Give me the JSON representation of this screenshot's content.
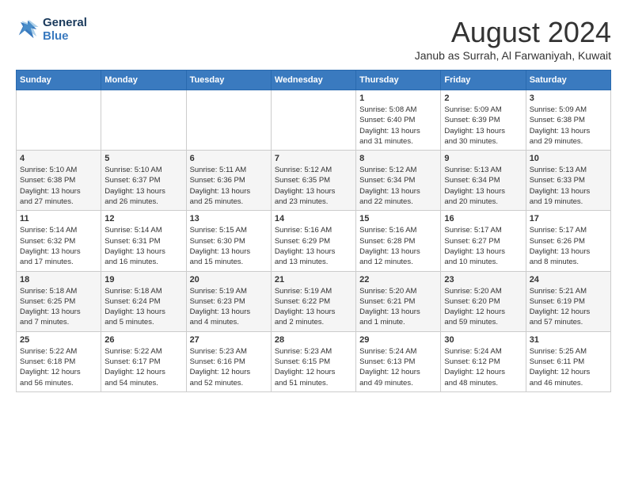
{
  "logo": {
    "line1": "General",
    "line2": "Blue"
  },
  "title": "August 2024",
  "location": "Janub as Surrah, Al Farwaniyah, Kuwait",
  "days_of_week": [
    "Sunday",
    "Monday",
    "Tuesday",
    "Wednesday",
    "Thursday",
    "Friday",
    "Saturday"
  ],
  "weeks": [
    [
      {
        "day": "",
        "detail": ""
      },
      {
        "day": "",
        "detail": ""
      },
      {
        "day": "",
        "detail": ""
      },
      {
        "day": "",
        "detail": ""
      },
      {
        "day": "1",
        "detail": "Sunrise: 5:08 AM\nSunset: 6:40 PM\nDaylight: 13 hours\nand 31 minutes."
      },
      {
        "day": "2",
        "detail": "Sunrise: 5:09 AM\nSunset: 6:39 PM\nDaylight: 13 hours\nand 30 minutes."
      },
      {
        "day": "3",
        "detail": "Sunrise: 5:09 AM\nSunset: 6:38 PM\nDaylight: 13 hours\nand 29 minutes."
      }
    ],
    [
      {
        "day": "4",
        "detail": "Sunrise: 5:10 AM\nSunset: 6:38 PM\nDaylight: 13 hours\nand 27 minutes."
      },
      {
        "day": "5",
        "detail": "Sunrise: 5:10 AM\nSunset: 6:37 PM\nDaylight: 13 hours\nand 26 minutes."
      },
      {
        "day": "6",
        "detail": "Sunrise: 5:11 AM\nSunset: 6:36 PM\nDaylight: 13 hours\nand 25 minutes."
      },
      {
        "day": "7",
        "detail": "Sunrise: 5:12 AM\nSunset: 6:35 PM\nDaylight: 13 hours\nand 23 minutes."
      },
      {
        "day": "8",
        "detail": "Sunrise: 5:12 AM\nSunset: 6:34 PM\nDaylight: 13 hours\nand 22 minutes."
      },
      {
        "day": "9",
        "detail": "Sunrise: 5:13 AM\nSunset: 6:34 PM\nDaylight: 13 hours\nand 20 minutes."
      },
      {
        "day": "10",
        "detail": "Sunrise: 5:13 AM\nSunset: 6:33 PM\nDaylight: 13 hours\nand 19 minutes."
      }
    ],
    [
      {
        "day": "11",
        "detail": "Sunrise: 5:14 AM\nSunset: 6:32 PM\nDaylight: 13 hours\nand 17 minutes."
      },
      {
        "day": "12",
        "detail": "Sunrise: 5:14 AM\nSunset: 6:31 PM\nDaylight: 13 hours\nand 16 minutes."
      },
      {
        "day": "13",
        "detail": "Sunrise: 5:15 AM\nSunset: 6:30 PM\nDaylight: 13 hours\nand 15 minutes."
      },
      {
        "day": "14",
        "detail": "Sunrise: 5:16 AM\nSunset: 6:29 PM\nDaylight: 13 hours\nand 13 minutes."
      },
      {
        "day": "15",
        "detail": "Sunrise: 5:16 AM\nSunset: 6:28 PM\nDaylight: 13 hours\nand 12 minutes."
      },
      {
        "day": "16",
        "detail": "Sunrise: 5:17 AM\nSunset: 6:27 PM\nDaylight: 13 hours\nand 10 minutes."
      },
      {
        "day": "17",
        "detail": "Sunrise: 5:17 AM\nSunset: 6:26 PM\nDaylight: 13 hours\nand 8 minutes."
      }
    ],
    [
      {
        "day": "18",
        "detail": "Sunrise: 5:18 AM\nSunset: 6:25 PM\nDaylight: 13 hours\nand 7 minutes."
      },
      {
        "day": "19",
        "detail": "Sunrise: 5:18 AM\nSunset: 6:24 PM\nDaylight: 13 hours\nand 5 minutes."
      },
      {
        "day": "20",
        "detail": "Sunrise: 5:19 AM\nSunset: 6:23 PM\nDaylight: 13 hours\nand 4 minutes."
      },
      {
        "day": "21",
        "detail": "Sunrise: 5:19 AM\nSunset: 6:22 PM\nDaylight: 13 hours\nand 2 minutes."
      },
      {
        "day": "22",
        "detail": "Sunrise: 5:20 AM\nSunset: 6:21 PM\nDaylight: 13 hours\nand 1 minute."
      },
      {
        "day": "23",
        "detail": "Sunrise: 5:20 AM\nSunset: 6:20 PM\nDaylight: 12 hours\nand 59 minutes."
      },
      {
        "day": "24",
        "detail": "Sunrise: 5:21 AM\nSunset: 6:19 PM\nDaylight: 12 hours\nand 57 minutes."
      }
    ],
    [
      {
        "day": "25",
        "detail": "Sunrise: 5:22 AM\nSunset: 6:18 PM\nDaylight: 12 hours\nand 56 minutes."
      },
      {
        "day": "26",
        "detail": "Sunrise: 5:22 AM\nSunset: 6:17 PM\nDaylight: 12 hours\nand 54 minutes."
      },
      {
        "day": "27",
        "detail": "Sunrise: 5:23 AM\nSunset: 6:16 PM\nDaylight: 12 hours\nand 52 minutes."
      },
      {
        "day": "28",
        "detail": "Sunrise: 5:23 AM\nSunset: 6:15 PM\nDaylight: 12 hours\nand 51 minutes."
      },
      {
        "day": "29",
        "detail": "Sunrise: 5:24 AM\nSunset: 6:13 PM\nDaylight: 12 hours\nand 49 minutes."
      },
      {
        "day": "30",
        "detail": "Sunrise: 5:24 AM\nSunset: 6:12 PM\nDaylight: 12 hours\nand 48 minutes."
      },
      {
        "day": "31",
        "detail": "Sunrise: 5:25 AM\nSunset: 6:11 PM\nDaylight: 12 hours\nand 46 minutes."
      }
    ]
  ]
}
